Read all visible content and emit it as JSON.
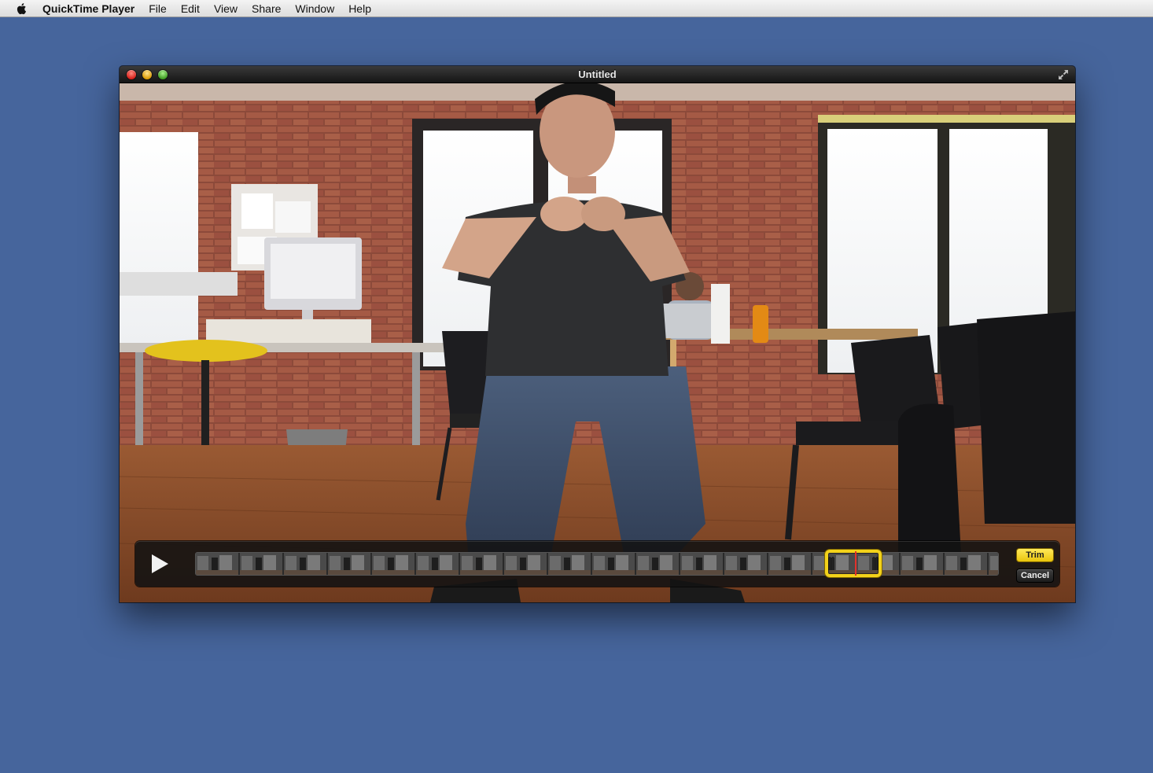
{
  "menubar": {
    "apple_icon": "apple-logo-icon",
    "items": [
      {
        "label": "QuickTime Player"
      },
      {
        "label": "File"
      },
      {
        "label": "Edit"
      },
      {
        "label": "View"
      },
      {
        "label": "Share"
      },
      {
        "label": "Window"
      },
      {
        "label": "Help"
      }
    ]
  },
  "window": {
    "title": "Untitled",
    "buttons": [
      "close",
      "minimize",
      "zoom"
    ],
    "fullscreen_icon": "fullscreen-arrows-icon"
  },
  "trim": {
    "play_icon": "play-icon",
    "trim_label": "Trim",
    "cancel_label": "Cancel",
    "selection_start_fraction": 0.785,
    "selection_end_fraction": 0.855,
    "accent_color": "#f3d21a",
    "playhead_color": "#e0322c"
  },
  "colors": {
    "desktop": "#46659c"
  }
}
